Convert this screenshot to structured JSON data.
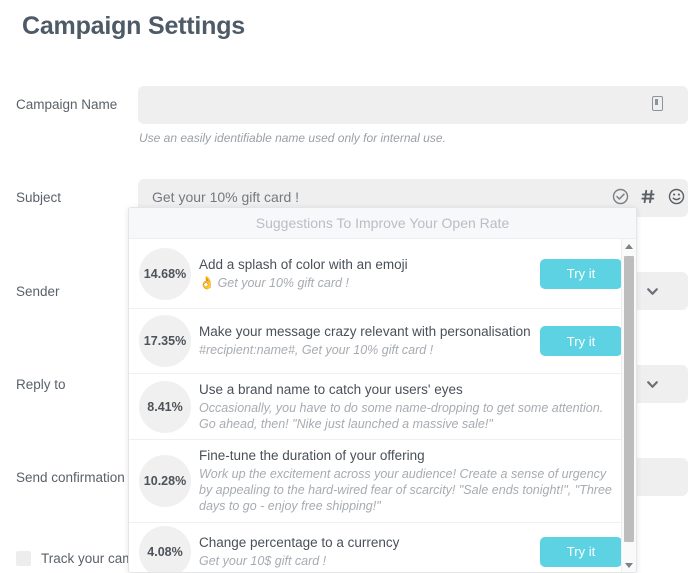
{
  "page_title": "Campaign Settings",
  "form": {
    "campaign_name": {
      "label": "Campaign Name",
      "value": "",
      "placeholder": "",
      "helper": "Use an easily identifiable name used only for internal use.",
      "icon": "save-note-icon"
    },
    "subject": {
      "label": "Subject",
      "value": "Get your 10% gift card !",
      "placeholder": "",
      "icons": [
        {
          "name": "check-circle-icon"
        },
        {
          "name": "hash-icon"
        },
        {
          "name": "emoji-smiley-icon"
        }
      ]
    },
    "sender": {
      "label": "Sender",
      "value": "",
      "placeholder": "",
      "dropdown_icon": "chevron-down-icon"
    },
    "reply_to": {
      "label": "Reply to",
      "value": "",
      "placeholder": "",
      "dropdown_icon": "chevron-down-icon"
    },
    "send_confirmation_to": {
      "label": "Send confirmation to",
      "value": "",
      "placeholder": ""
    },
    "track_analytics": {
      "label": "Track your campaign in Google Analytics",
      "checked": false
    }
  },
  "suggestions_panel": {
    "header": "Suggestions To Improve Your Open Rate",
    "button_label": "Try it",
    "accent_color": "#5cd2e3",
    "badge_bg": "#f0f0f0",
    "items": [
      {
        "percent": "14.68%",
        "title": "Add a splash of color with an emoji",
        "emoji": "👌",
        "subtitle": "Get your 10% gift card !",
        "has_button": true
      },
      {
        "percent": "17.35%",
        "title": "Make your message crazy relevant with personalisation",
        "emoji": "",
        "subtitle": "#recipient:name#, Get your 10% gift card !",
        "has_button": true
      },
      {
        "percent": "8.41%",
        "title": "Use a brand name to catch your users' eyes",
        "emoji": "",
        "subtitle": "Occasionally, you have to do some name-dropping to get some attention. Go ahead, then! \"Nike just launched a massive sale!\"",
        "has_button": false
      },
      {
        "percent": "10.28%",
        "title": "Fine-tune the duration of your offering",
        "emoji": "",
        "subtitle": "Work up the excitement across your audience! Create a sense of urgency by appealing to the hard-wired fear of scarcity! \"Sale ends tonight!\", \"Three days to go - enjoy free shipping!\"",
        "has_button": false
      },
      {
        "percent": "4.08%",
        "title": "Change percentage to a currency",
        "emoji": "",
        "subtitle": "Get your 10$ gift card !",
        "has_button": true
      }
    ],
    "scrollbar": {
      "up_icon": "scroll-up-arrow-icon",
      "down_icon": "scroll-down-arrow-icon"
    }
  }
}
